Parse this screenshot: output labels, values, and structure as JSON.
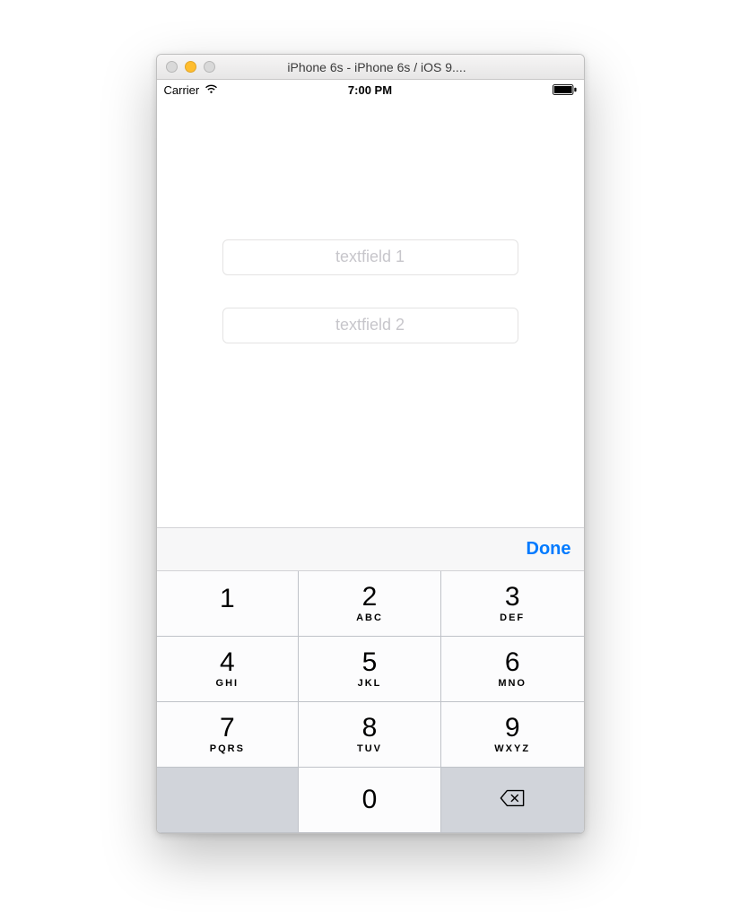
{
  "window": {
    "title": "iPhone 6s - iPhone 6s / iOS 9...."
  },
  "statusbar": {
    "carrier": "Carrier",
    "time": "7:00 PM"
  },
  "fields": {
    "tf1_placeholder": "textfield 1",
    "tf2_placeholder": "textfield 2"
  },
  "accessory": {
    "done_label": "Done"
  },
  "keypad": {
    "k1": {
      "digit": "1",
      "letters": ""
    },
    "k2": {
      "digit": "2",
      "letters": "ABC"
    },
    "k3": {
      "digit": "3",
      "letters": "DEF"
    },
    "k4": {
      "digit": "4",
      "letters": "GHI"
    },
    "k5": {
      "digit": "5",
      "letters": "JKL"
    },
    "k6": {
      "digit": "6",
      "letters": "MNO"
    },
    "k7": {
      "digit": "7",
      "letters": "PQRS"
    },
    "k8": {
      "digit": "8",
      "letters": "TUV"
    },
    "k9": {
      "digit": "9",
      "letters": "WXYZ"
    },
    "k0": {
      "digit": "0",
      "letters": ""
    }
  }
}
